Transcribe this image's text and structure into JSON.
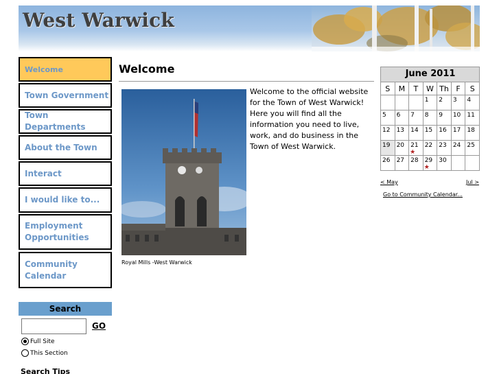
{
  "header": {
    "title": "West Warwick"
  },
  "nav": {
    "items": [
      {
        "label": "Welcome"
      },
      {
        "label": "Town Government"
      },
      {
        "label": "Town Departments"
      },
      {
        "label": "About the Town"
      },
      {
        "label": "Interact"
      },
      {
        "label": "I would like to..."
      },
      {
        "label": "Employment Opportunities"
      },
      {
        "label": "Community Calendar"
      }
    ]
  },
  "search": {
    "heading": "Search",
    "input_value": "",
    "go_label": "GO",
    "options": [
      "Full Site",
      "This Section"
    ],
    "selected": "Full Site",
    "tips_label": "Search Tips"
  },
  "main": {
    "title": "Welcome",
    "photo_caption": "Royal Mills -West Warwick",
    "welcome_text": "Welcome to the official website for the Town of West Warwick!  Here you will find all the information you need to live, work, and do business in the Town of West Warwick."
  },
  "calendar": {
    "month_label": "June 2011",
    "weekdays": [
      "S",
      "M",
      "T",
      "W",
      "Th",
      "F",
      "S"
    ],
    "weeks": [
      [
        "",
        "",
        "",
        "1",
        "2",
        "3",
        "4"
      ],
      [
        "5",
        "6",
        "7",
        "8",
        "9",
        "10",
        "11"
      ],
      [
        "12",
        "13",
        "14",
        "15",
        "16",
        "17",
        "18"
      ],
      [
        "19",
        "20",
        "21",
        "22",
        "23",
        "24",
        "25"
      ],
      [
        "26",
        "27",
        "28",
        "29",
        "30",
        "",
        ""
      ]
    ],
    "event_days": [
      "21",
      "29"
    ],
    "highlight_day": "19",
    "prev_link": "< May",
    "next_link": "Jul >",
    "community_link": "Go to Community Calendar...",
    "colors": {
      "event_star": "#b22222",
      "header_bg": "#d9d9d9"
    }
  },
  "colors": {
    "nav_text": "#6d98c8",
    "nav_active_bg": "#ffc95a",
    "search_head_bg": "#6a9fcd"
  }
}
